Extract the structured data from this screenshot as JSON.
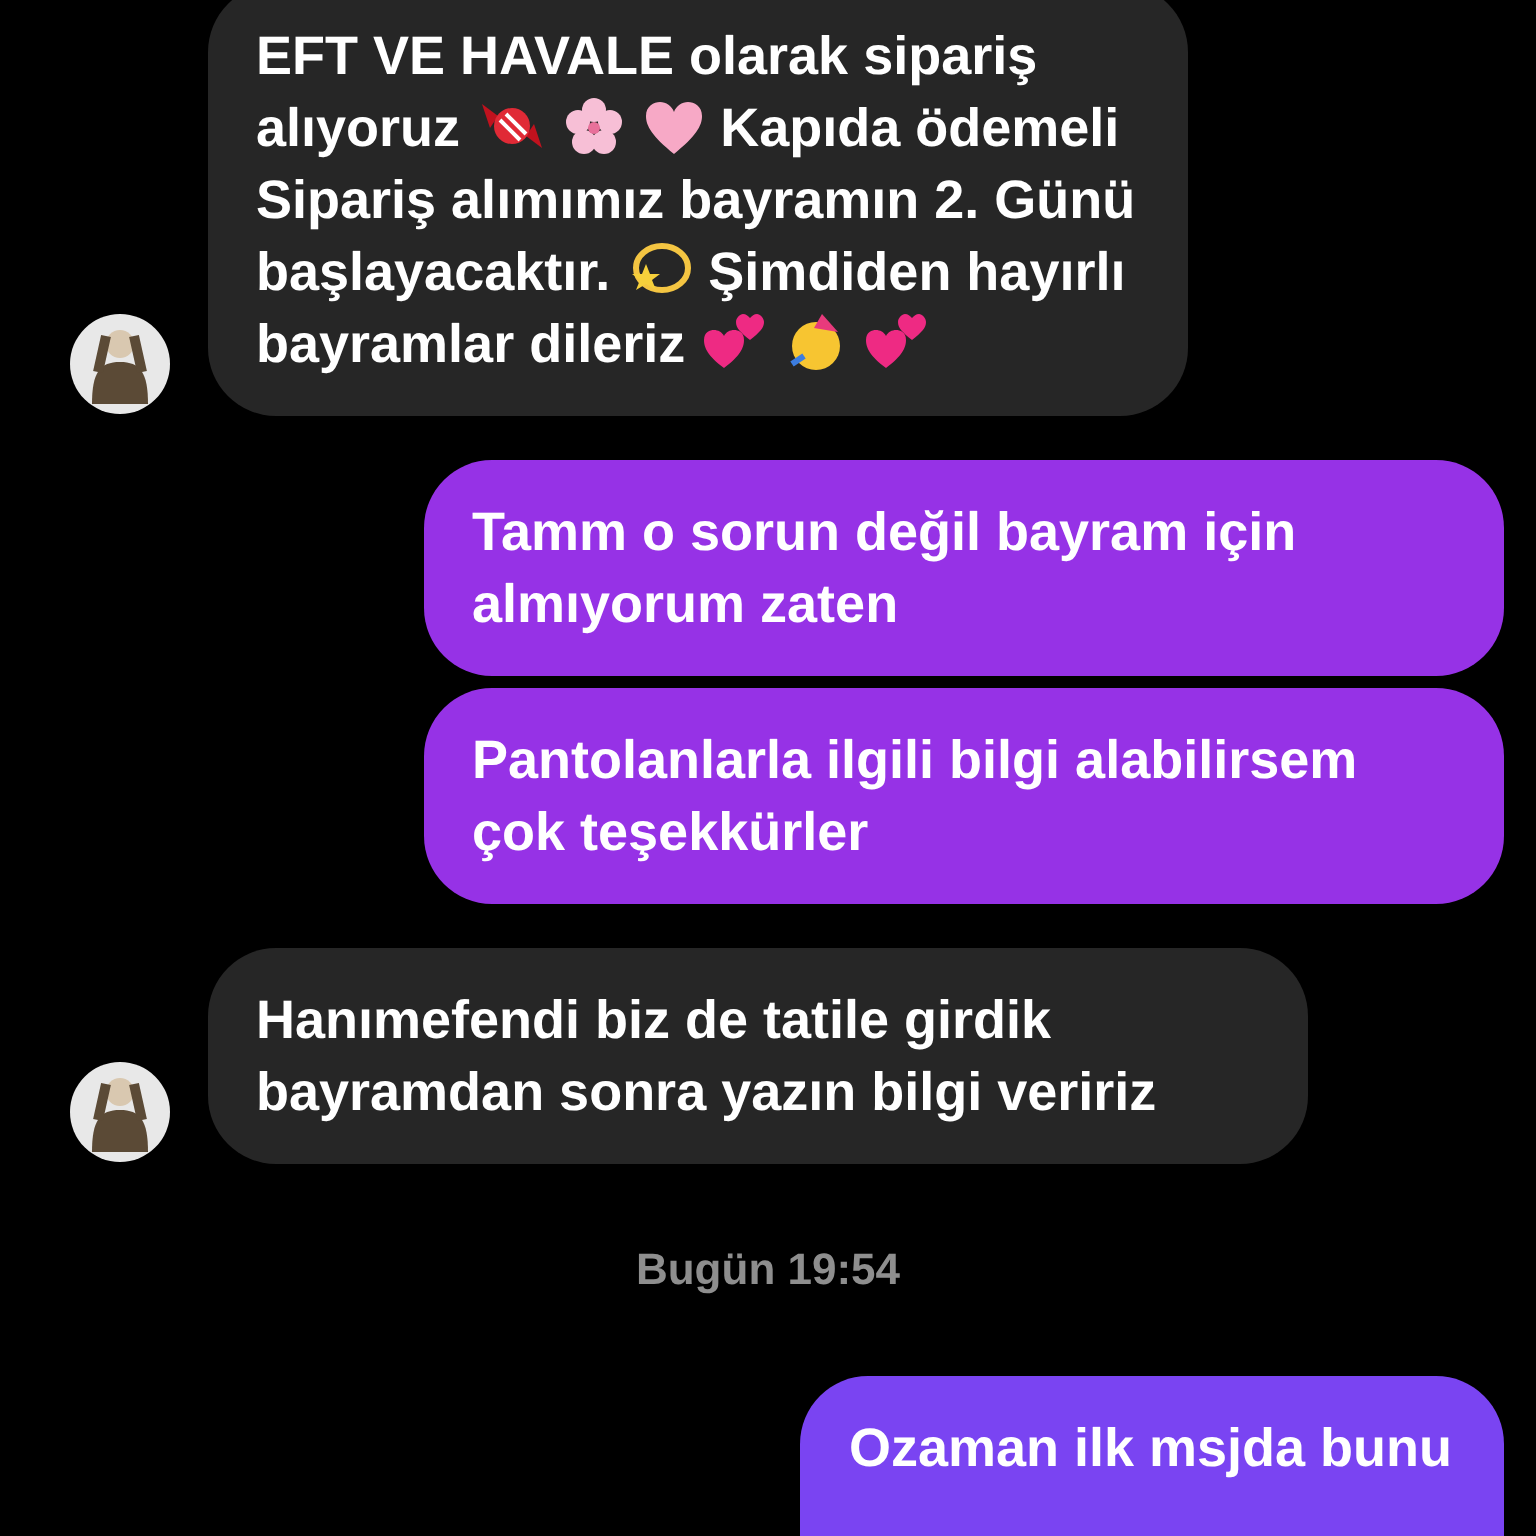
{
  "messages": [
    {
      "kind": "received",
      "avatar": true,
      "parts": [
        {
          "kind": "text",
          "text": "EFT VE HAVALE olarak sipariş"
        },
        {
          "kind": "break"
        },
        {
          "kind": "text",
          "text": "alıyoruz"
        },
        {
          "kind": "candy"
        },
        {
          "kind": "blossom"
        },
        {
          "kind": "heart"
        },
        {
          "kind": "text",
          "text": "Kapıda ödemeli"
        },
        {
          "kind": "break"
        },
        {
          "kind": "text",
          "text": "Sipariş alımımız bayramın 2. Günü"
        },
        {
          "kind": "break"
        },
        {
          "kind": "text",
          "text": "başlayacaktır."
        },
        {
          "kind": "dizzy"
        },
        {
          "kind": "text",
          "text": "Şimdiden hayırlı"
        },
        {
          "kind": "break"
        },
        {
          "kind": "text",
          "text": "bayramlar dileriz"
        },
        {
          "kind": "hearts"
        },
        {
          "kind": "party"
        },
        {
          "kind": "hearts"
        }
      ]
    },
    {
      "kind": "sent",
      "parts": [
        {
          "kind": "text",
          "text": "Tamm o sorun değil bayram için almıyorum zaten"
        }
      ]
    },
    {
      "kind": "sent",
      "parts": [
        {
          "kind": "text",
          "text": "Pantolanlarla ilgili bilgi alabilirsem çok teşekkürler"
        }
      ]
    },
    {
      "kind": "received",
      "avatar": true,
      "parts": [
        {
          "kind": "text",
          "text": "Hanımefendi biz de tatile girdik bayramdan sonra yazın bilgi veririz"
        }
      ]
    },
    {
      "kind": "time",
      "text": "Bugün 19:54"
    },
    {
      "kind": "sent",
      "parts": [
        {
          "kind": "text",
          "text": "Ozaman ilk msjda bunu"
        }
      ]
    }
  ]
}
